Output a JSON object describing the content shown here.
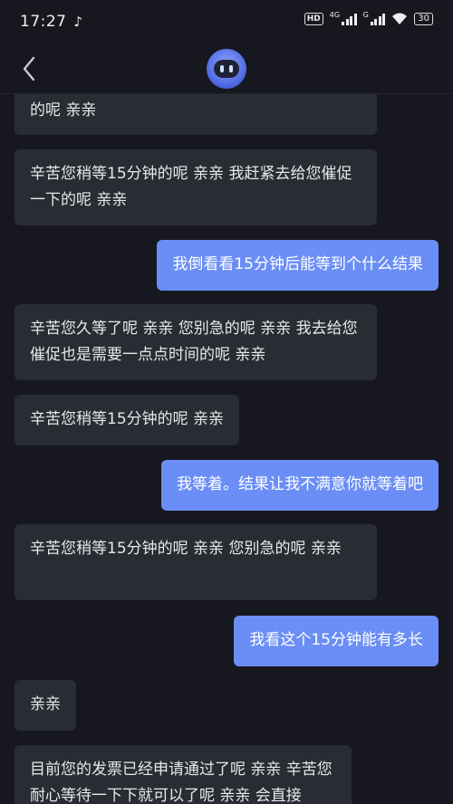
{
  "status_bar": {
    "time": "17:27",
    "hd": "HD",
    "network_1": "4G",
    "network_2": "G",
    "battery": "30"
  },
  "nav": {
    "back_icon": "chevron-left-icon",
    "avatar_icon": "robot-avatar-icon"
  },
  "messages": [
    {
      "side": "in",
      "text": "的呢 亲亲"
    },
    {
      "side": "in",
      "text": "辛苦您稍等15分钟的呢 亲亲 我赶紧去给您催促一下的呢 亲亲"
    },
    {
      "side": "out",
      "text": "我倒看看15分钟后能等到个什么结果"
    },
    {
      "side": "in",
      "text": "辛苦您久等了呢 亲亲 您别急的呢 亲亲 我去给您催促也是需要一点点时间的呢 亲亲"
    },
    {
      "side": "in",
      "text": "辛苦您稍等15分钟的呢 亲亲"
    },
    {
      "side": "out",
      "text": "我等着。结果让我不满意你就等着吧"
    },
    {
      "side": "in",
      "text": "辛苦您稍等15分钟的呢 亲亲 您别急的呢 亲亲"
    },
    {
      "side": "out",
      "text": "我看这个15分钟能有多长"
    },
    {
      "side": "in",
      "text": "亲亲"
    },
    {
      "side": "in",
      "text": "目前您的发票已经申请通过了呢 亲亲 辛苦您耐心等待一下下就可以了呢 亲亲 会直接"
    }
  ],
  "colors": {
    "background": "#17181f",
    "incoming_bubble": "#2a2c34",
    "outgoing_bubble": "#6a8ef5"
  }
}
